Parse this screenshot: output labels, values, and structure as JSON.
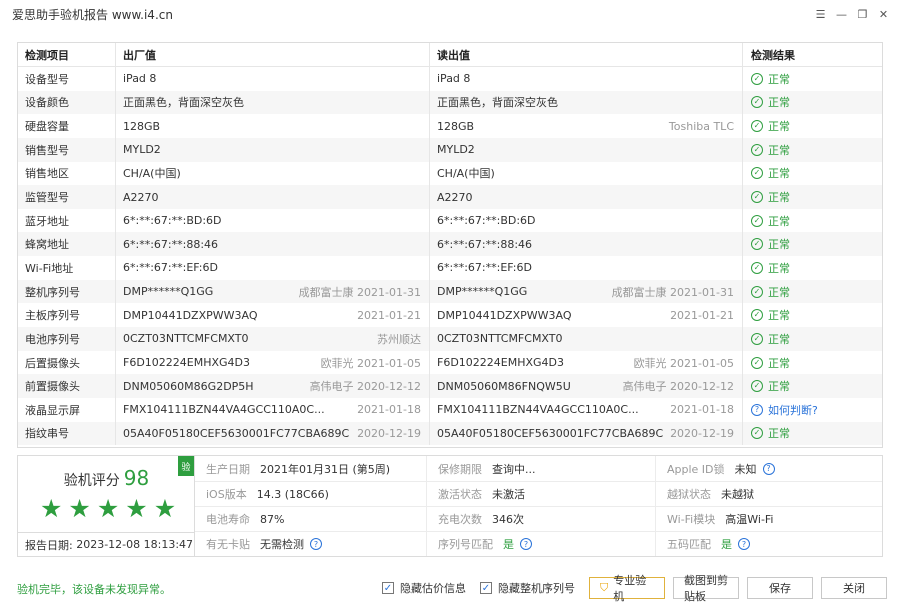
{
  "window": {
    "title": "爱思助手验机报告 www.i4.cn"
  },
  "table": {
    "headers": [
      "检测项目",
      "出厂值",
      "读出值",
      "检测结果"
    ],
    "rows": [
      {
        "item": "设备型号",
        "factory": "iPad 8",
        "factory_note": "",
        "read": "iPad 8",
        "read_note": "",
        "result": "正常",
        "status": "ok"
      },
      {
        "item": "设备颜色",
        "factory": "正面黑色，背面深空灰色",
        "factory_note": "",
        "read": "正面黑色，背面深空灰色",
        "read_note": "",
        "result": "正常",
        "status": "ok"
      },
      {
        "item": "硬盘容量",
        "factory": "128GB",
        "factory_note": "",
        "read": "128GB",
        "read_note": "Toshiba TLC",
        "result": "正常",
        "status": "ok"
      },
      {
        "item": "销售型号",
        "factory": "MYLD2",
        "factory_note": "",
        "read": "MYLD2",
        "read_note": "",
        "result": "正常",
        "status": "ok"
      },
      {
        "item": "销售地区",
        "factory": "CH/A(中国)",
        "factory_note": "",
        "read": "CH/A(中国)",
        "read_note": "",
        "result": "正常",
        "status": "ok"
      },
      {
        "item": "监管型号",
        "factory": "A2270",
        "factory_note": "",
        "read": "A2270",
        "read_note": "",
        "result": "正常",
        "status": "ok"
      },
      {
        "item": "蓝牙地址",
        "factory": "6*:**:67:**:BD:6D",
        "factory_note": "",
        "read": "6*:**:67:**:BD:6D",
        "read_note": "",
        "result": "正常",
        "status": "ok"
      },
      {
        "item": "蜂窝地址",
        "factory": "6*:**:67:**:88:46",
        "factory_note": "",
        "read": "6*:**:67:**:88:46",
        "read_note": "",
        "result": "正常",
        "status": "ok"
      },
      {
        "item": "Wi-Fi地址",
        "factory": "6*:**:67:**:EF:6D",
        "factory_note": "",
        "read": "6*:**:67:**:EF:6D",
        "read_note": "",
        "result": "正常",
        "status": "ok"
      },
      {
        "item": "整机序列号",
        "factory": "DMP******Q1GG",
        "factory_note": "成都富士康 2021-01-31",
        "read": "DMP******Q1GG",
        "read_note": "成都富士康 2021-01-31",
        "result": "正常",
        "status": "ok"
      },
      {
        "item": "主板序列号",
        "factory": "DMP10441DZXPWW3AQ",
        "factory_note": "2021-01-21",
        "read": "DMP10441DZXPWW3AQ",
        "read_note": "2021-01-21",
        "result": "正常",
        "status": "ok"
      },
      {
        "item": "电池序列号",
        "factory": "0CZT03NTTCMFCMXT0",
        "factory_note": "苏州顺达",
        "read": "0CZT03NTTCMFCMXT0",
        "read_note": "",
        "result": "正常",
        "status": "ok"
      },
      {
        "item": "后置摄像头",
        "factory": "F6D102224EMHXG4D3",
        "factory_note": "欧菲光 2021-01-05",
        "read": "F6D102224EMHXG4D3",
        "read_note": "欧菲光 2021-01-05",
        "result": "正常",
        "status": "ok"
      },
      {
        "item": "前置摄像头",
        "factory": "DNM05060M86G2DP5H",
        "factory_note": "高伟电子 2020-12-12",
        "read": "DNM05060M86FNQW5U",
        "read_note": "高伟电子 2020-12-12",
        "result": "正常",
        "status": "ok"
      },
      {
        "item": "液晶显示屏",
        "factory": "FMX104111BZN44VA4GCC110A0C...",
        "factory_note": "2021-01-18",
        "read": "FMX104111BZN44VA4GCC110A0C...",
        "read_note": "2021-01-18",
        "result": "如何判断?",
        "status": "question"
      },
      {
        "item": "指纹串号",
        "factory": "05A40F05180CEF5630001FC77CBA689C",
        "factory_note": "2020-12-19",
        "read": "05A40F05180CEF5630001FC77CBA689C",
        "read_note": "2020-12-19",
        "result": "正常",
        "status": "ok"
      }
    ]
  },
  "summary": {
    "score_label": "验机评分",
    "score": "98",
    "stars": 5,
    "badge": "验",
    "report_date_label": "报告日期:",
    "report_date": "2023-12-08 18:13:47",
    "info": [
      {
        "key": "生产日期",
        "value": "2021年01月31日 (第5周)",
        "help": false,
        "green": false
      },
      {
        "key": "保修期限",
        "value": "查询中...",
        "help": false,
        "green": false
      },
      {
        "key": "Apple ID锁",
        "value": "未知",
        "help": true,
        "green": false
      },
      {
        "key": "iOS版本",
        "value": "14.3 (18C66)",
        "help": false,
        "green": false
      },
      {
        "key": "激活状态",
        "value": "未激活",
        "help": false,
        "green": false
      },
      {
        "key": "越狱状态",
        "value": "未越狱",
        "help": false,
        "green": false
      },
      {
        "key": "电池寿命",
        "value": "87%",
        "help": false,
        "green": false
      },
      {
        "key": "充电次数",
        "value": "346次",
        "help": false,
        "green": false
      },
      {
        "key": "Wi-Fi模块",
        "value": "高温Wi-Fi",
        "help": false,
        "green": false
      },
      {
        "key": "有无卡贴",
        "value": "无需检测",
        "help": true,
        "green": false
      },
      {
        "key": "序列号匹配",
        "value": "是",
        "help": true,
        "green": true
      },
      {
        "key": "五码匹配",
        "value": "是",
        "help": true,
        "green": true
      }
    ]
  },
  "footer": {
    "status": "验机完毕，该设备未发现异常。",
    "hide_price_label": "隐藏估价信息",
    "hide_serial_label": "隐藏整机序列号",
    "pro_label": "专业验机",
    "copy_label": "截图到剪贴板",
    "save_label": "保存",
    "close_label": "关闭"
  }
}
